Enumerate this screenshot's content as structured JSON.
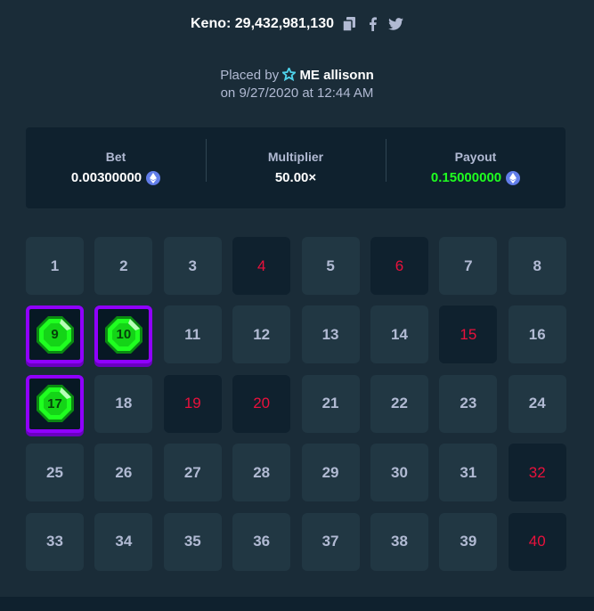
{
  "header": {
    "title": "Keno: 29,432,981,130",
    "icons": [
      "copy-icon",
      "facebook-icon",
      "twitter-icon"
    ]
  },
  "placement": {
    "placed_by_label": "Placed by",
    "username": "ME allisonn",
    "date_line": "on 9/27/2020 at 12:44 AM"
  },
  "summary": {
    "bet_label": "Bet",
    "bet_value": "0.00300000",
    "multiplier_label": "Multiplier",
    "multiplier_value": "50.00×",
    "payout_label": "Payout",
    "payout_value": "0.15000000",
    "currency_icon": "ethereum-icon"
  },
  "colors": {
    "background": "#1a2c38",
    "tile": "#213743",
    "miss_text": "#e9113c",
    "payout_green": "#1fff20",
    "hit_border": "#9000ff",
    "gem_green": "#1fff20"
  },
  "board": {
    "tiles": [
      {
        "n": "1",
        "state": "none"
      },
      {
        "n": "2",
        "state": "none"
      },
      {
        "n": "3",
        "state": "none"
      },
      {
        "n": "4",
        "state": "miss"
      },
      {
        "n": "5",
        "state": "none"
      },
      {
        "n": "6",
        "state": "miss"
      },
      {
        "n": "7",
        "state": "none"
      },
      {
        "n": "8",
        "state": "none"
      },
      {
        "n": "9",
        "state": "hit"
      },
      {
        "n": "10",
        "state": "hit"
      },
      {
        "n": "11",
        "state": "none"
      },
      {
        "n": "12",
        "state": "none"
      },
      {
        "n": "13",
        "state": "none"
      },
      {
        "n": "14",
        "state": "none"
      },
      {
        "n": "15",
        "state": "miss"
      },
      {
        "n": "16",
        "state": "none"
      },
      {
        "n": "17",
        "state": "hit"
      },
      {
        "n": "18",
        "state": "none"
      },
      {
        "n": "19",
        "state": "miss"
      },
      {
        "n": "20",
        "state": "miss"
      },
      {
        "n": "21",
        "state": "none"
      },
      {
        "n": "22",
        "state": "none"
      },
      {
        "n": "23",
        "state": "none"
      },
      {
        "n": "24",
        "state": "none"
      },
      {
        "n": "25",
        "state": "none"
      },
      {
        "n": "26",
        "state": "none"
      },
      {
        "n": "27",
        "state": "none"
      },
      {
        "n": "28",
        "state": "none"
      },
      {
        "n": "29",
        "state": "none"
      },
      {
        "n": "30",
        "state": "none"
      },
      {
        "n": "31",
        "state": "none"
      },
      {
        "n": "32",
        "state": "miss"
      },
      {
        "n": "33",
        "state": "none"
      },
      {
        "n": "34",
        "state": "none"
      },
      {
        "n": "35",
        "state": "none"
      },
      {
        "n": "36",
        "state": "none"
      },
      {
        "n": "37",
        "state": "none"
      },
      {
        "n": "38",
        "state": "none"
      },
      {
        "n": "39",
        "state": "none"
      },
      {
        "n": "40",
        "state": "miss"
      }
    ]
  }
}
